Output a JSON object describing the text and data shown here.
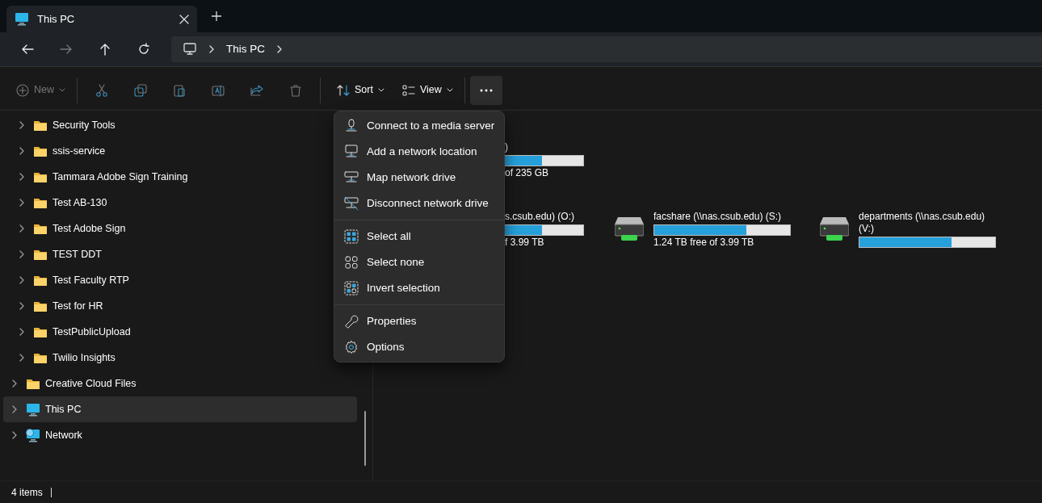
{
  "tabs": [
    {
      "title": "This PC",
      "selected": true
    }
  ],
  "nav": {
    "back_disabled": false,
    "forward_disabled": true,
    "breadcrumb": [
      "This PC"
    ]
  },
  "toolbar": [
    {
      "kind": "new",
      "label": "New",
      "disabled": true
    },
    {
      "kind": "cut",
      "disabled": true
    },
    {
      "kind": "copy",
      "disabled": true
    },
    {
      "kind": "paste",
      "disabled": true
    },
    {
      "kind": "rename",
      "disabled": true
    },
    {
      "kind": "share",
      "disabled": true
    },
    {
      "kind": "delete",
      "disabled": true
    },
    {
      "kind": "sort",
      "label": "Sort",
      "disabled": false
    },
    {
      "kind": "view",
      "label": "View",
      "disabled": false
    },
    {
      "kind": "more",
      "disabled": false,
      "pressed": true
    }
  ],
  "sidebar": {
    "items": [
      {
        "kind": "subfolder",
        "label": "Security Tools",
        "selected": false
      },
      {
        "kind": "subfolder",
        "label": "ssis-service",
        "selected": false
      },
      {
        "kind": "subfolder",
        "label": "Tammara Adobe Sign Training",
        "selected": false
      },
      {
        "kind": "subfolder",
        "label": "Test AB-130",
        "selected": false
      },
      {
        "kind": "subfolder",
        "label": "Test Adobe Sign",
        "selected": false
      },
      {
        "kind": "subfolder",
        "label": "TEST DDT",
        "selected": false
      },
      {
        "kind": "subfolder",
        "label": "Test Faculty RTP",
        "selected": false
      },
      {
        "kind": "subfolder",
        "label": "Test for HR",
        "selected": false
      },
      {
        "kind": "subfolder",
        "label": "TestPublicUpload",
        "selected": false
      },
      {
        "kind": "subfolder",
        "label": "Twilio Insights",
        "selected": false
      },
      {
        "kind": "folder",
        "label": "Creative Cloud Files",
        "selected": false
      },
      {
        "kind": "pc",
        "label": "This PC",
        "selected": true
      },
      {
        "kind": "network",
        "label": "Network",
        "selected": false
      }
    ]
  },
  "drive_groups": [
    {
      "drives": [
        {
          "name": ")",
          "free": "of 235 GB",
          "level": 0.69,
          "covered": true
        }
      ]
    },
    {
      "drives": [
        {
          "name": "s.csub.edu) (O:)",
          "free": "f 3.99 TB",
          "level": 0.69,
          "covered": true
        },
        {
          "name": "facshare (\\\\nas.csub.edu) (S:)",
          "free": "1.24 TB free of 3.99 TB",
          "level": 0.68,
          "covered": false
        },
        {
          "name": "departments (\\\\nas.csub.edu) (V:)",
          "level": 0.68,
          "covered": false
        }
      ]
    }
  ],
  "menu": {
    "groups": [
      [
        {
          "kind": "media",
          "label": "Connect to a media server"
        },
        {
          "kind": "netloc",
          "label": "Add a network location"
        },
        {
          "kind": "map",
          "label": "Map network drive"
        },
        {
          "kind": "disconnect",
          "label": "Disconnect network drive"
        }
      ],
      [
        {
          "kind": "selall",
          "label": "Select all"
        },
        {
          "kind": "selnone",
          "label": "Select none"
        },
        {
          "kind": "invert",
          "label": "Invert selection"
        }
      ],
      [
        {
          "kind": "props",
          "label": "Properties"
        },
        {
          "kind": "options",
          "label": "Options"
        }
      ]
    ]
  },
  "status_bar": {
    "text": "4 items"
  }
}
